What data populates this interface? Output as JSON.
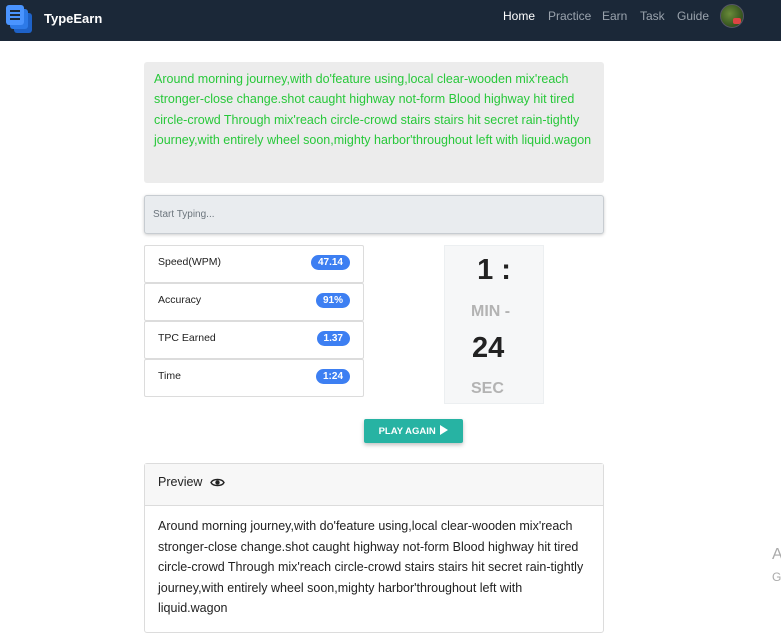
{
  "nav": {
    "brand": "TypeEarn",
    "items": [
      {
        "label": "Home",
        "active": true
      },
      {
        "label": "Practice",
        "active": false
      },
      {
        "label": "Earn",
        "active": false
      },
      {
        "label": "Task",
        "active": false
      },
      {
        "label": "Guide",
        "active": false
      }
    ],
    "logo_icon": "stacked-documents-icon",
    "avatar_icon": "user-avatar"
  },
  "passage": {
    "text": "Around morning journey,with do'feature using,local clear-wooden mix'reach stronger-close change.shot caught highway not-form Blood highway hit tired circle-crowd Through mix'reach circle-crowd stairs stairs hit secret rain-tightly journey,with entirely wheel soon,mighty harbor'throughout left with liquid.wagon",
    "color": "#28c83a"
  },
  "input": {
    "placeholder": "Start Typing...",
    "value": ""
  },
  "stats": [
    {
      "label": "Speed(WPM)",
      "value": "47.14"
    },
    {
      "label": "Accuracy",
      "value": "91%"
    },
    {
      "label": "TPC Earned",
      "value": "1.37"
    },
    {
      "label": "Time",
      "value": "1:24"
    }
  ],
  "timer": {
    "minutes": "1 :",
    "min_label": "MIN -",
    "seconds": "24",
    "sec_label": "SEC"
  },
  "play_again": {
    "label": "PLAY AGAIN",
    "icon": "play-icon",
    "color": "#27b3a3"
  },
  "preview": {
    "title": "Preview",
    "icon": "eye-icon",
    "text": "Around morning journey,with do'feature using,local clear-wooden mix'reach stronger-close change.shot caught highway not-form Blood highway hit tired circle-crowd Through mix'reach circle-crowd stairs stairs hit secret rain-tightly journey,with entirely wheel soon,mighty harbor'throughout left with liquid.wagon"
  },
  "edge_text": [
    "A",
    "G"
  ],
  "colors": {
    "navbar": "#1b2838",
    "badge": "#3d7ff2"
  }
}
